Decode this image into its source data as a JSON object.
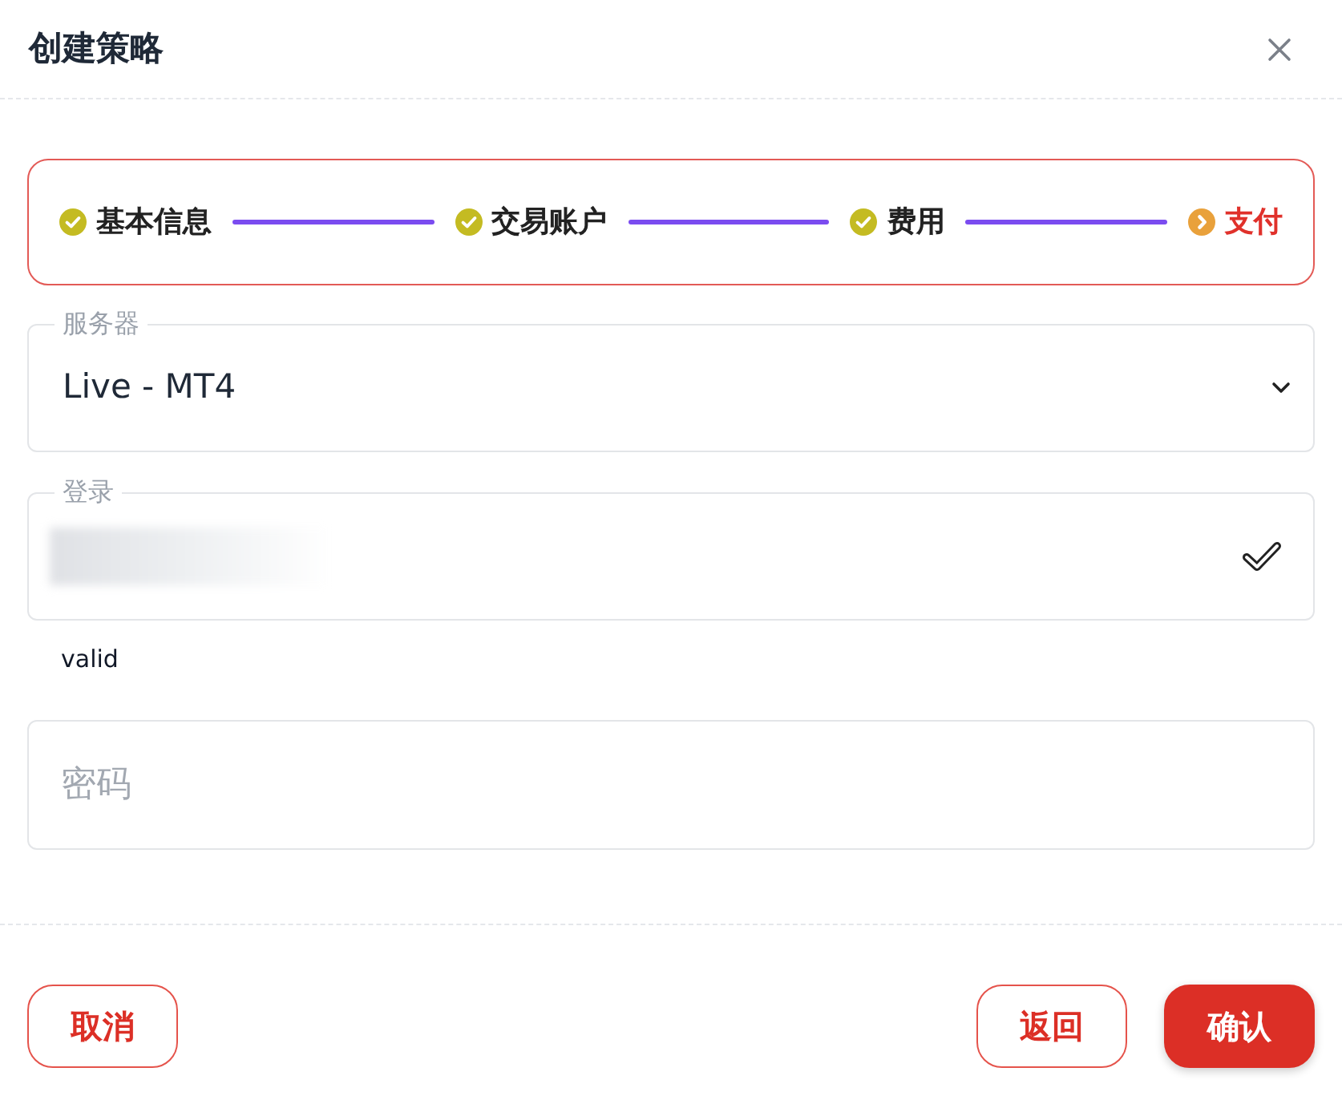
{
  "dialog": {
    "title": "创建策略"
  },
  "steps": [
    {
      "label": "基本信息",
      "completed": true
    },
    {
      "label": "交易账户",
      "completed": true
    },
    {
      "label": "费用",
      "completed": true
    },
    {
      "label": "支付",
      "completed": false
    }
  ],
  "fields": [
    {
      "kind": "select",
      "label": "服务器",
      "value": "Live - MT4"
    },
    {
      "kind": "text",
      "label": "登录",
      "redacted": true,
      "valid": true,
      "helper": "valid"
    },
    {
      "kind": "password",
      "placeholder": "密码"
    }
  ],
  "buttons": [
    {
      "label": "取消",
      "kind": "outline"
    },
    {
      "label": "返回",
      "kind": "outline"
    },
    {
      "label": "确认",
      "kind": "primary"
    }
  ]
}
